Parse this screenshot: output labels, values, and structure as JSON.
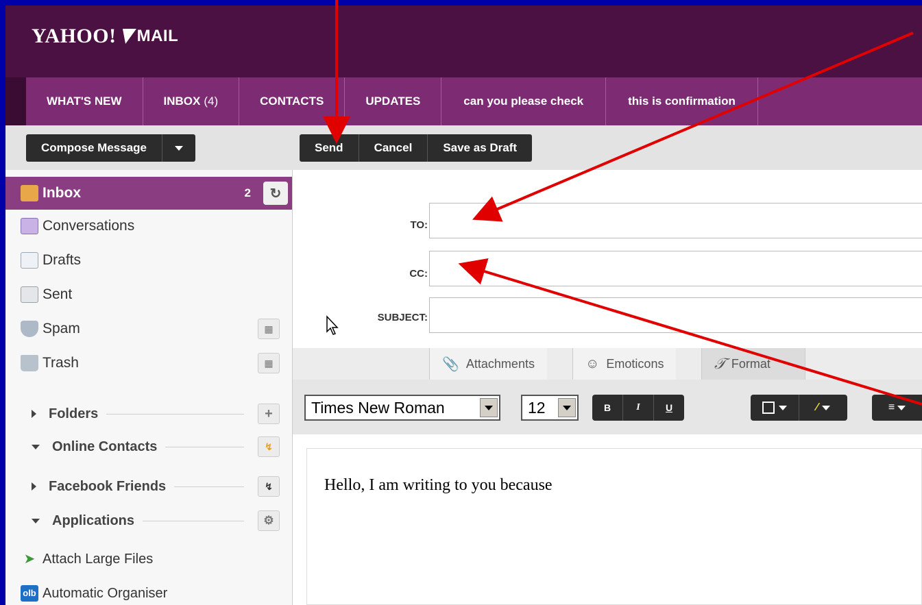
{
  "app": {
    "logo_text": "YAHOO!",
    "logo_product": "MAIL"
  },
  "tabs": [
    {
      "label": "WHAT'S NEW"
    },
    {
      "label": "INBOX",
      "count": "(4)"
    },
    {
      "label": "CONTACTS"
    },
    {
      "label": "UPDATES"
    },
    {
      "label": "can you please check"
    },
    {
      "label": "this is confirmation"
    }
  ],
  "toolbar": {
    "compose_label": "Compose Message",
    "send_label": "Send",
    "cancel_label": "Cancel",
    "draft_label": "Save as Draft"
  },
  "sidebar": {
    "items": [
      {
        "label": "Inbox",
        "count": "2",
        "icon": "inbox-icon"
      },
      {
        "label": "Conversations",
        "icon": "conversations-icon"
      },
      {
        "label": "Drafts",
        "icon": "drafts-icon"
      },
      {
        "label": "Sent",
        "icon": "sent-icon"
      },
      {
        "label": "Spam",
        "icon": "spam-icon"
      },
      {
        "label": "Trash",
        "icon": "trash-icon"
      }
    ],
    "sections": [
      {
        "label": "Folders",
        "expanded": false
      },
      {
        "label": "Online Contacts",
        "expanded": true
      },
      {
        "label": "Facebook Friends",
        "expanded": false
      },
      {
        "label": "Applications",
        "expanded": true
      }
    ],
    "apps": [
      {
        "label": "Attach Large Files"
      },
      {
        "label": "Automatic Organiser",
        "badge": "olb"
      }
    ]
  },
  "compose": {
    "to_label": "TO:",
    "cc_label": "CC:",
    "subject_label": "SUBJECT:",
    "to_value": "",
    "cc_value": "",
    "subject_value": ""
  },
  "attach_tabs": {
    "attachments": "Attachments",
    "emoticons": "Emoticons",
    "format": "Format"
  },
  "format": {
    "font": "Times New Roman",
    "size": "12",
    "bold": "B",
    "italic": "I",
    "underline": "U"
  },
  "body_text": "Hello, I am writing to you because",
  "colors": {
    "background": "#0000a8",
    "header": "#4b1142",
    "tabs": "#7d2c73",
    "active_item": "#8a3d80",
    "annotation_arrow": "#e00000"
  }
}
